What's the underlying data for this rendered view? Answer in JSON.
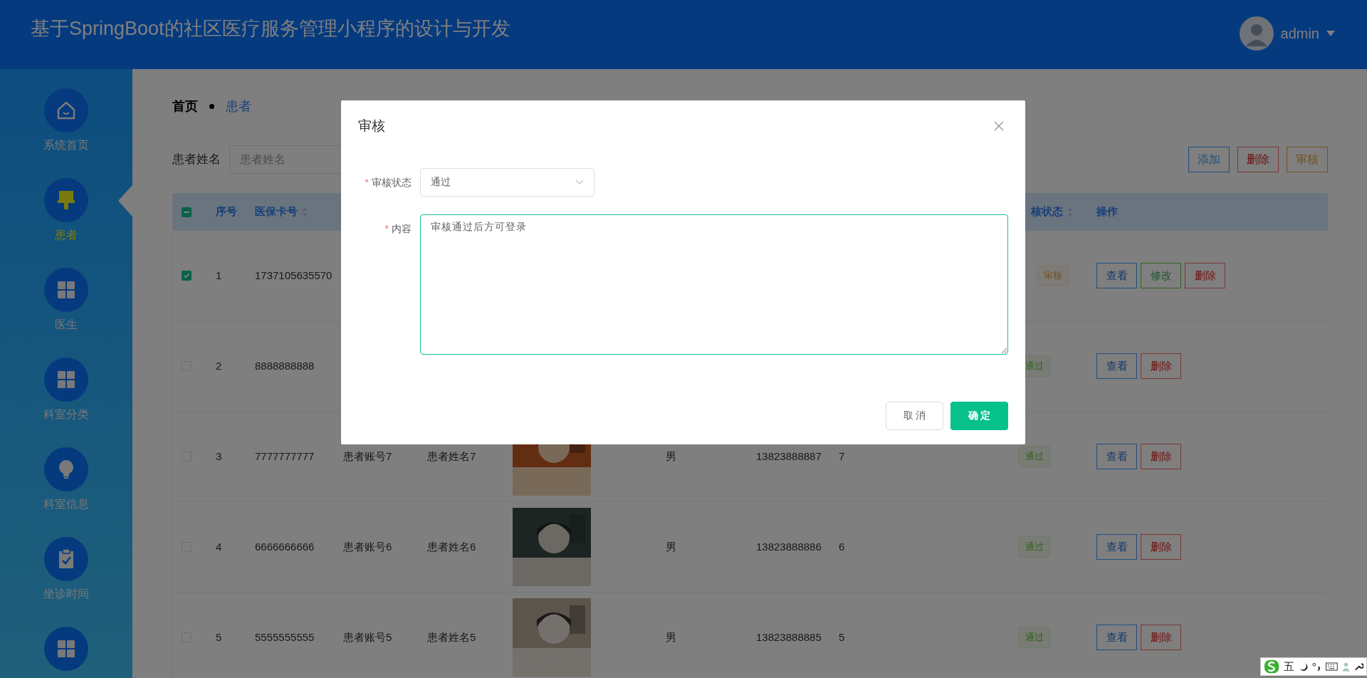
{
  "header": {
    "title": "基于SpringBoot的社区医疗服务管理小程序的设计与开发",
    "user": "admin"
  },
  "sidebar": {
    "items": [
      {
        "label": "系统首页",
        "selected": false
      },
      {
        "label": "患者",
        "selected": true
      },
      {
        "label": "医生",
        "selected": false
      },
      {
        "label": "科室分类",
        "selected": false
      },
      {
        "label": "科室信息",
        "selected": false
      },
      {
        "label": "坐诊时间",
        "selected": false
      },
      {
        "selected": false
      }
    ]
  },
  "breadcrumb": [
    {
      "label": "首页",
      "selected": false
    },
    {
      "label": "患者",
      "selected": true
    }
  ],
  "search": {
    "label": "患者姓名",
    "placeholder": "患者姓名"
  },
  "toolbar": [
    {
      "label": "添加",
      "kind": "add"
    },
    {
      "label": "删除",
      "kind": "delete"
    },
    {
      "label": "审核",
      "kind": "review"
    }
  ],
  "table": {
    "header": {
      "indeterminate": true,
      "index": "序号",
      "card": {
        "label": "医保卡号",
        "sortable": true
      },
      "status": {
        "label": "核状态",
        "sortable": true
      },
      "actions": "操作"
    },
    "rows": [
      {
        "selected": true,
        "index": "1",
        "card": "1737105635570",
        "status": {
          "text": "审核",
          "kind": "pending"
        },
        "actions": [
          {
            "label": "查看",
            "kind": "view"
          },
          {
            "label": "修改",
            "kind": "edit"
          },
          {
            "label": "删除",
            "kind": "delete"
          }
        ]
      },
      {
        "selected": false,
        "index": "2",
        "card": "8888888888",
        "status": {
          "text": "通过",
          "kind": "passed"
        },
        "actions": [
          {
            "label": "查看",
            "kind": "view"
          },
          {
            "label": "删除",
            "kind": "delete"
          }
        ]
      },
      {
        "selected": false,
        "index": "3",
        "card": "7777777777",
        "account": "患者账号7",
        "name": "患者姓名7",
        "photo": {
          "kind": "picture"
        },
        "gender": "男",
        "phone": "13823888887",
        "column_10": "7",
        "status": {
          "text": "通过",
          "kind": "passed"
        },
        "actions": [
          {
            "label": "查看",
            "kind": "view"
          },
          {
            "label": "删除",
            "kind": "delete"
          }
        ]
      },
      {
        "selected": false,
        "index": "4",
        "card": "6666666666",
        "account": "患者账号6",
        "name": "患者姓名6",
        "photo": {
          "kind": "picture"
        },
        "gender": "男",
        "phone": "13823888886",
        "column_10": "6",
        "status": {
          "text": "通过",
          "kind": "passed"
        },
        "actions": [
          {
            "label": "查看",
            "kind": "view"
          },
          {
            "label": "删除",
            "kind": "delete"
          }
        ]
      },
      {
        "selected": false,
        "index": "5",
        "card": "5555555555",
        "account": "患者账号5",
        "name": "患者姓名5",
        "photo": {
          "kind": "picture"
        },
        "gender": "男",
        "phone": "13823888885",
        "column_10": "5",
        "status": {
          "text": "通过",
          "kind": "passed"
        },
        "actions": [
          {
            "label": "查看",
            "kind": "view"
          },
          {
            "label": "删除",
            "kind": "delete"
          }
        ]
      }
    ]
  },
  "dialog": {
    "title": "审核",
    "fields": [
      {
        "kind": "select",
        "label": "审核状态",
        "required_mark": "*",
        "value": "通过"
      },
      {
        "kind": "textarea",
        "label": "内容",
        "required_mark": "*",
        "value": "审核通过后方可登录"
      }
    ],
    "buttons": [
      {
        "label": "取 消",
        "kind": "secondary"
      },
      {
        "label": "确 定",
        "kind": "primary"
      }
    ]
  },
  "ime_toolbar": {
    "mode": "五"
  }
}
